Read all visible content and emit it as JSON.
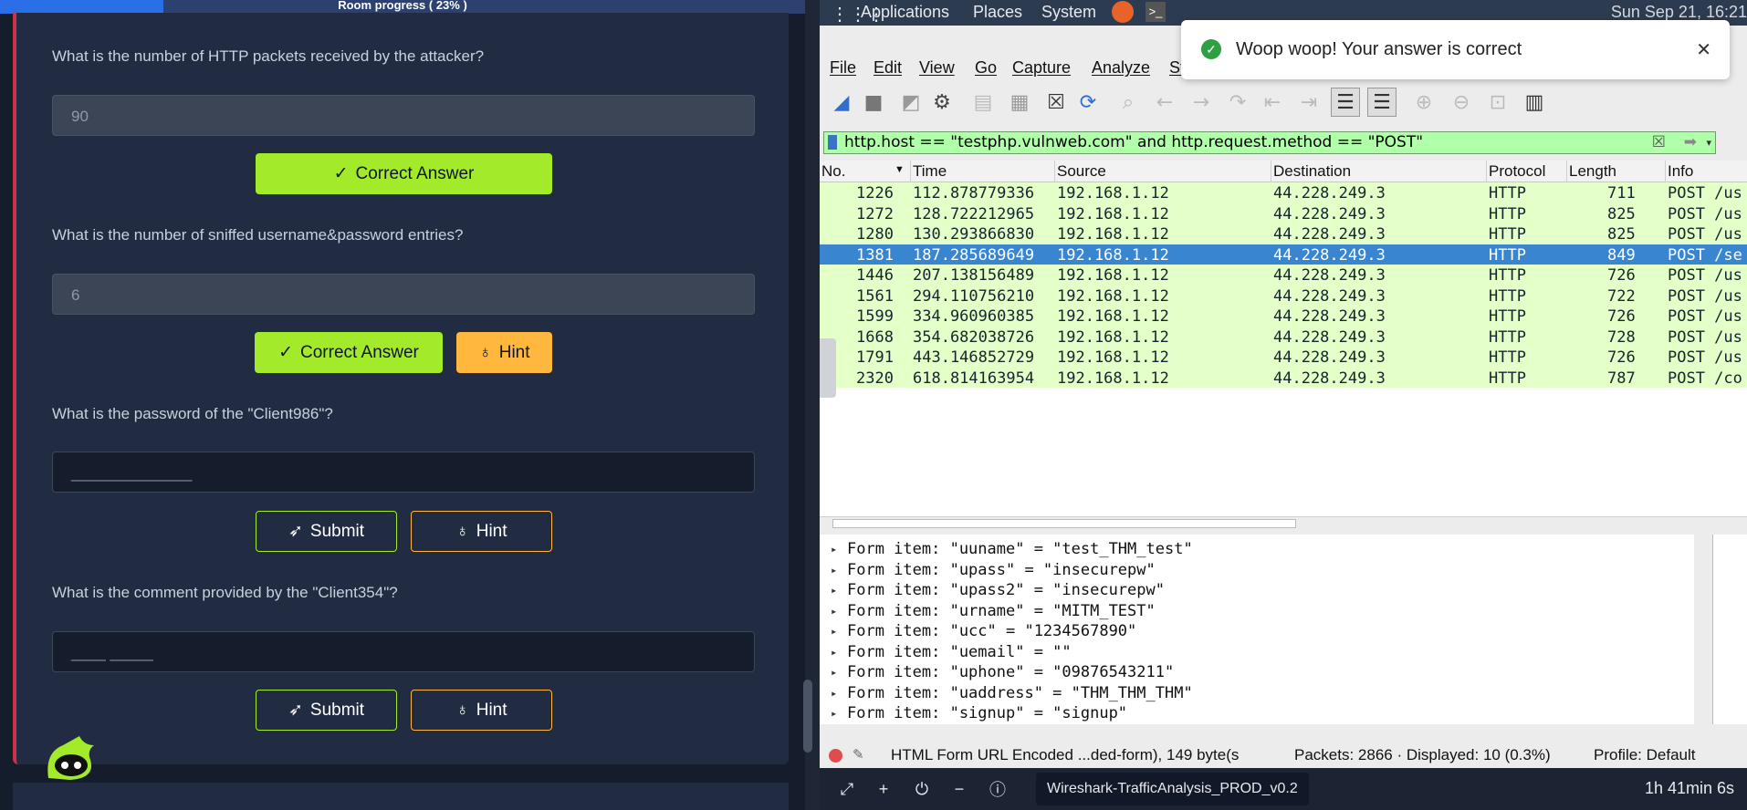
{
  "room": {
    "progress_label": "Room progress ( 23% )",
    "progress_fraction": 0.23
  },
  "questions": [
    {
      "text": "What is the number of HTTP packets received by the attacker?",
      "answer": "90",
      "buttons": [
        "Correct Answer"
      ]
    },
    {
      "text": "What is the number of sniffed username&password entries?",
      "answer": "6",
      "buttons": [
        "Correct Answer",
        "Hint"
      ]
    },
    {
      "text": "What is the password of the \"Client986\"?",
      "placeholder": "______________",
      "buttons": [
        "Submit",
        "Hint"
      ]
    },
    {
      "text": "What is the comment provided by the \"Client354\"?",
      "placeholder": "____ _____",
      "buttons": [
        "Submit",
        "Hint"
      ]
    }
  ],
  "desktop": {
    "menu": [
      "Applications",
      "Places",
      "System"
    ],
    "clock": "Sun Sep 21, 16:21"
  },
  "toast": {
    "message": "Woop woop! Your answer is correct"
  },
  "wireshark": {
    "menu": [
      "File",
      "Edit",
      "View",
      "Go",
      "Capture",
      "Analyze",
      "St"
    ],
    "filter": "http.host == \"testphp.vulnweb.com\" and http.request.method == \"POST\"",
    "columns": [
      "No.",
      "Time",
      "Source",
      "Destination",
      "Protocol",
      "Length",
      "Info"
    ],
    "packets": [
      {
        "no": "1226",
        "time": "112.878779336",
        "src": "192.168.1.12",
        "dst": "44.228.249.3",
        "proto": "HTTP",
        "len": "711",
        "info": "POST /us"
      },
      {
        "no": "1272",
        "time": "128.722212965",
        "src": "192.168.1.12",
        "dst": "44.228.249.3",
        "proto": "HTTP",
        "len": "825",
        "info": "POST /us"
      },
      {
        "no": "1280",
        "time": "130.293866830",
        "src": "192.168.1.12",
        "dst": "44.228.249.3",
        "proto": "HTTP",
        "len": "825",
        "info": "POST /us"
      },
      {
        "no": "1381",
        "time": "187.285689649",
        "src": "192.168.1.12",
        "dst": "44.228.249.3",
        "proto": "HTTP",
        "len": "849",
        "info": "POST /se",
        "selected": true
      },
      {
        "no": "1446",
        "time": "207.138156489",
        "src": "192.168.1.12",
        "dst": "44.228.249.3",
        "proto": "HTTP",
        "len": "726",
        "info": "POST /us"
      },
      {
        "no": "1561",
        "time": "294.110756210",
        "src": "192.168.1.12",
        "dst": "44.228.249.3",
        "proto": "HTTP",
        "len": "722",
        "info": "POST /us"
      },
      {
        "no": "1599",
        "time": "334.960960385",
        "src": "192.168.1.12",
        "dst": "44.228.249.3",
        "proto": "HTTP",
        "len": "726",
        "info": "POST /us"
      },
      {
        "no": "1668",
        "time": "354.682038726",
        "src": "192.168.1.12",
        "dst": "44.228.249.3",
        "proto": "HTTP",
        "len": "728",
        "info": "POST /us"
      },
      {
        "no": "1791",
        "time": "443.146852729",
        "src": "192.168.1.12",
        "dst": "44.228.249.3",
        "proto": "HTTP",
        "len": "726",
        "info": "POST /us"
      },
      {
        "no": "2320",
        "time": "618.814163954",
        "src": "192.168.1.12",
        "dst": "44.228.249.3",
        "proto": "HTTP",
        "len": "787",
        "info": "POST /co"
      }
    ],
    "details": [
      "Form item: \"uuname\" = \"test_THM_test\"",
      "Form item: \"upass\" = \"insecurepw\"",
      "Form item: \"upass2\" = \"insecurepw\"",
      "Form item: \"urname\" = \"MITM_TEST\"",
      "Form item: \"ucc\" = \"1234567890\"",
      "Form item: \"uemail\" = \"\"",
      "Form item: \"uphone\" = \"09876543211\"",
      "Form item: \"uaddress\" = \"THM_THM_THM\"",
      "Form item: \"signup\" = \"signup\""
    ],
    "status": {
      "field_info": "HTML Form URL Encoded ...ded-form), 149 byte(s",
      "packets": "Packets: 2866 · Displayed: 10 (0.3%)",
      "profile": "Profile: Default"
    }
  },
  "taskbar": {
    "window_title": "Wireshark-TrafficAnalysis_PROD_v0.2",
    "timer": "1h 41min 6s"
  },
  "colors": {
    "accent_green": "#a3ea2a",
    "hint_orange": "#ffb83d",
    "selected_row": "#3985d0",
    "http_row": "#e4ffc7"
  }
}
